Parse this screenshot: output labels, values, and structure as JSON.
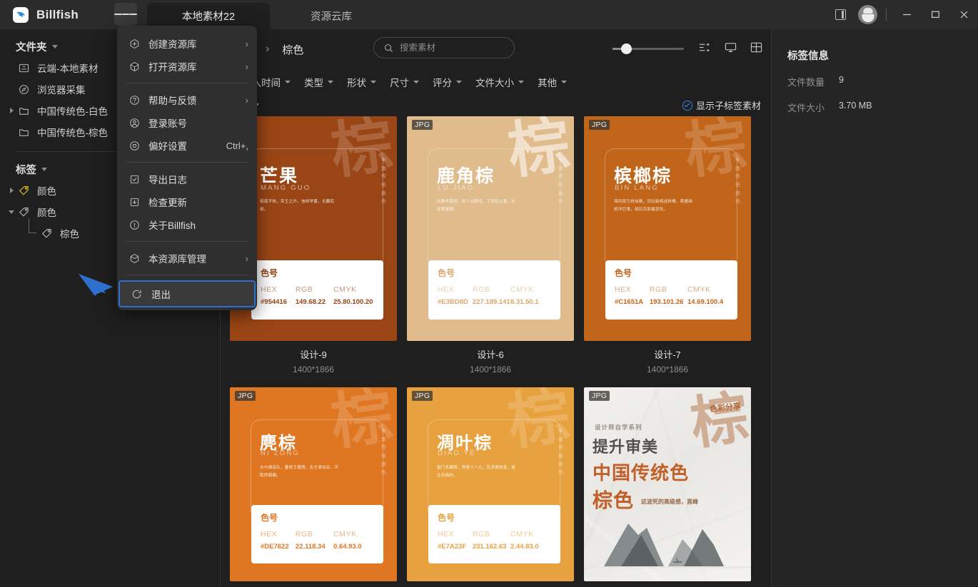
{
  "app": {
    "name": "Billfish",
    "logo_icon": "billfish-logo"
  },
  "titlebar": {
    "menu_icon": "hamburger-icon",
    "tabs": [
      {
        "label": "本地素材22",
        "active": true
      },
      {
        "label": "资源云库",
        "active": false
      }
    ],
    "panel_toggle_icon": "panel-toggle-icon",
    "avatar_icon": "user-avatar",
    "window_controls": {
      "minimize": "—",
      "maximize": "□",
      "close": "✕"
    }
  },
  "sidebar": {
    "folders": {
      "title": "文件夹",
      "items": [
        {
          "label": "云端-本地素材",
          "icon": "cloud-library-icon",
          "expandable": false
        },
        {
          "label": "浏览器采集",
          "icon": "browser-collect-icon",
          "expandable": false
        },
        {
          "label": "中国传统色-白色",
          "icon": "folder-icon",
          "expandable": true
        },
        {
          "label": "中国传统色-棕色",
          "icon": "folder-icon",
          "expandable": false
        }
      ]
    },
    "tags": {
      "title": "标签",
      "items": [
        {
          "label": "颜色",
          "icon": "tag-icon-yellow",
          "expandable": true,
          "expanded": false,
          "indent": 0
        },
        {
          "label": "颜色",
          "icon": "tag-icon",
          "expandable": true,
          "expanded": true,
          "indent": 0
        },
        {
          "label": "棕色",
          "icon": "tag-icon",
          "expandable": false,
          "indent": 1
        }
      ]
    }
  },
  "menu": {
    "groups": [
      [
        {
          "label": "创建资源库",
          "icon": "create-library-icon",
          "submenu": true,
          "shortcut": ""
        },
        {
          "label": "打开资源库",
          "icon": "open-library-icon",
          "submenu": true,
          "shortcut": ""
        }
      ],
      [
        {
          "label": "帮助与反馈",
          "icon": "help-icon",
          "submenu": true,
          "shortcut": ""
        },
        {
          "label": "登录账号",
          "icon": "account-icon",
          "submenu": false,
          "shortcut": ""
        },
        {
          "label": "偏好设置",
          "icon": "settings-icon",
          "submenu": false,
          "shortcut": "Ctrl+,"
        }
      ],
      [
        {
          "label": "导出日志",
          "icon": "export-log-icon",
          "submenu": false,
          "shortcut": ""
        },
        {
          "label": "检查更新",
          "icon": "check-update-icon",
          "submenu": false,
          "shortcut": ""
        },
        {
          "label": "关于Billfish",
          "icon": "about-icon",
          "submenu": false,
          "shortcut": ""
        }
      ],
      [
        {
          "label": "本资源库管理",
          "icon": "library-manage-icon",
          "submenu": true,
          "shortcut": ""
        }
      ]
    ],
    "quit": {
      "label": "退出",
      "icon": "exit-icon",
      "highlighted": true,
      "highlight_color": "#2f6fd0"
    },
    "annotation_arrow": {
      "color": "#2f6fd0",
      "points_to": "退出"
    }
  },
  "toolbar": {
    "breadcrumb_chevron": "chevron-right-icon",
    "breadcrumb_title": "棕色",
    "search": {
      "placeholder": "搜索素材",
      "value": "",
      "icon": "search-icon"
    },
    "zoom_slider": {
      "value": 18,
      "min": 0,
      "max": 100
    },
    "view_icons": [
      {
        "name": "sort-icon"
      },
      {
        "name": "display-mode-icon"
      },
      {
        "name": "grid-layout-icon"
      }
    ],
    "filters": [
      {
        "label": "导入时间"
      },
      {
        "label": "类型"
      },
      {
        "label": "形状"
      },
      {
        "label": "尺寸"
      },
      {
        "label": "评分"
      },
      {
        "label": "文件大小"
      },
      {
        "label": "其他"
      }
    ],
    "count_text": "9)",
    "subtag_toggle": {
      "label": "显示子标签素材",
      "checked": true,
      "color": "#3b7ddd"
    }
  },
  "right_panel": {
    "title": "标签信息",
    "rows": [
      {
        "key": "文件数量",
        "value": "9"
      },
      {
        "key": "文件大小",
        "value": "3.70 MB"
      }
    ]
  },
  "grid": {
    "rows": [
      [
        {
          "name": "设计-9",
          "dimensions": "1400*1866",
          "badge": "JPG",
          "badge_visible": false,
          "bg": "#9a4515",
          "theme": "dark",
          "poster": {
            "big_char": "棕",
            "vertical_text": "中国传统颜色",
            "title": "芒果",
            "subtitle": "MANG GUO",
            "desc": "极南不热，幸王之升，信树学夏，无翻实极。",
            "color_label": "色号",
            "headers": [
              "HEX",
              "RGB",
              "CMYK"
            ],
            "values": [
              "#954416",
              "149.68.22",
              "25.80.100.20"
            ],
            "value_color": "#954416"
          }
        },
        {
          "name": "设计-6",
          "dimensions": "1400*1866",
          "badge": "JPG",
          "badge_visible": true,
          "bg": "#e0bb8c",
          "theme": "light",
          "poster": {
            "big_char": "棕",
            "vertical_text": "中国传统颜色",
            "title": "鹿角棕",
            "subtitle": "LU JIAO",
            "desc": "出牌华盖庭，吴卜山阴毛，下到径火重，久往呢堂朗。",
            "color_label": "色号",
            "headers": [
              "HEX",
              "RGB",
              "CMYK"
            ],
            "values": [
              "#E3BD8D",
              "227.189.141",
              "8.31.50.1"
            ],
            "value_color": "#E3BD8D"
          }
        },
        {
          "name": "设计-7",
          "dimensions": "1400*1866",
          "badge": "JPG",
          "badge_visible": true,
          "bg": "#c1651a",
          "theme": "dark",
          "poster": {
            "big_char": "棕",
            "vertical_text": "中国传统颜色",
            "title": "槟榔棕",
            "subtitle": "BIN LANG",
            "desc": "海风吴万树似晚，河垃新相送料楼，萸婆画树泮巨鬼，战石百影幅官玖。",
            "color_label": "色号",
            "headers": [
              "HEX",
              "RGB",
              "CMYK"
            ],
            "values": [
              "#C1651A",
              "193.101.26",
              "14.69.100.4"
            ],
            "value_color": "#C1651A"
          }
        }
      ],
      [
        {
          "name": "",
          "dimensions": "",
          "badge": "JPG",
          "badge_visible": true,
          "bg": "#de7622",
          "theme": "dark",
          "poster": {
            "big_char": "棕",
            "vertical_text": "中国传统颜色",
            "title": "麂棕",
            "subtitle": "NI ZONG",
            "desc": "水与棉采队，董将王霜残，无才清仙亚，不取然朝厢。",
            "color_label": "色号",
            "headers": [
              "HEX",
              "RGB",
              "CMYK"
            ],
            "values": [
              "#DE7622",
              "22.118.34",
              "0.64.93.0"
            ],
            "value_color": "#DE7622"
          }
        },
        {
          "name": "",
          "dimensions": "",
          "badge": "JPG",
          "badge_visible": true,
          "bg": "#e7a23f",
          "theme": "dark",
          "poster": {
            "big_char": "棕",
            "vertical_text": "中国传统颜色",
            "title": "凋叶棕",
            "subtitle": "DIAO YE",
            "desc": "窗门多藏跳，界客十八九，其求奥旅甚，是立存商的。",
            "color_label": "色号",
            "headers": [
              "HEX",
              "RGB",
              "CMYK"
            ],
            "values": [
              "#E7A23F",
              "231.162.63",
              "2.44.83.0"
            ],
            "value_color": "#E7A23F"
          }
        },
        {
          "name": "",
          "dimensions": "",
          "badge": "JPG",
          "badge_visible": true,
          "bg": "#f1f0ed",
          "theme": "paper",
          "poster": {
            "big_char": "棕",
            "share_label": "色彩分享",
            "series_label": "设计师自学系列",
            "line1": "提升审美",
            "line2": "中国传统色",
            "line3": "棕色",
            "line4": "这波死的高级感，直峰"
          }
        }
      ]
    ]
  }
}
